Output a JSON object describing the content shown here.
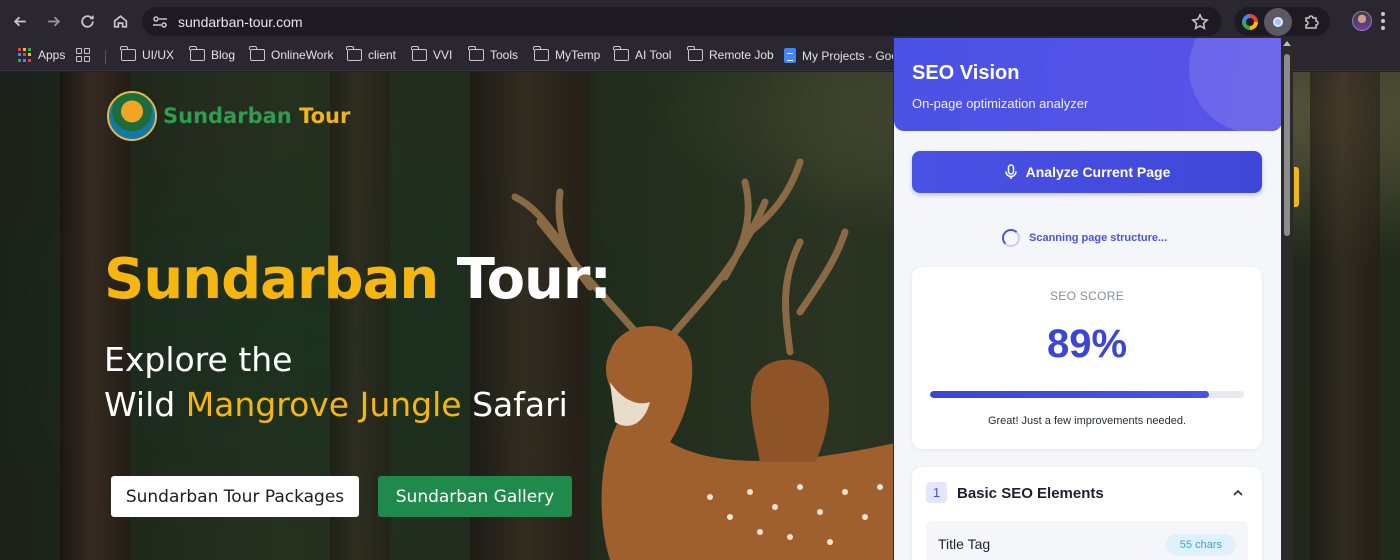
{
  "browser": {
    "url": "sundarban-tour.com",
    "bookmarks": [
      {
        "label": "Apps",
        "icon": "apps-grid-icon"
      },
      {
        "label": "",
        "icon": "tab-groups-icon"
      },
      {
        "label": "UI/UX",
        "icon": "folder-icon"
      },
      {
        "label": "Blog",
        "icon": "folder-icon"
      },
      {
        "label": "OnlineWork",
        "icon": "folder-icon"
      },
      {
        "label": "client",
        "icon": "folder-icon"
      },
      {
        "label": "VVI",
        "icon": "folder-icon"
      },
      {
        "label": "Tools",
        "icon": "folder-icon"
      },
      {
        "label": "MyTemp",
        "icon": "folder-icon"
      },
      {
        "label": "AI Tool",
        "icon": "folder-icon"
      },
      {
        "label": "Remote Job",
        "icon": "folder-icon"
      },
      {
        "label": "My Projects - Goo",
        "icon": "google-docs-icon"
      }
    ]
  },
  "site": {
    "logo": {
      "part1": "Sundarban",
      "part2": "Tour"
    },
    "hero": {
      "title_highlight": "Sundarban",
      "title_rest": " Tour:",
      "line1": "Explore the",
      "line2_a": "Wild ",
      "line2_highlight": "Mangrove Jungle",
      "line2_b": " Safari"
    },
    "buttons": {
      "packages": "Sundarban Tour Packages",
      "gallery": "Sundarban Gallery"
    }
  },
  "panel": {
    "title": "SEO Vision",
    "subtitle": "On-page optimization analyzer",
    "analyze_label": "Analyze Current Page",
    "status": "Scanning page structure...",
    "score": {
      "label": "SEO SCORE",
      "value": "89%",
      "percent": 89,
      "message": "Great! Just a few improvements needed."
    },
    "section": {
      "number": "1",
      "title": "Basic SEO Elements",
      "row_label": "Title Tag",
      "row_badge": "55 chars"
    }
  },
  "colors": {
    "accent": "#4a52e6",
    "brand_yellow": "#f5b611",
    "brand_green": "#1f8a4c"
  }
}
